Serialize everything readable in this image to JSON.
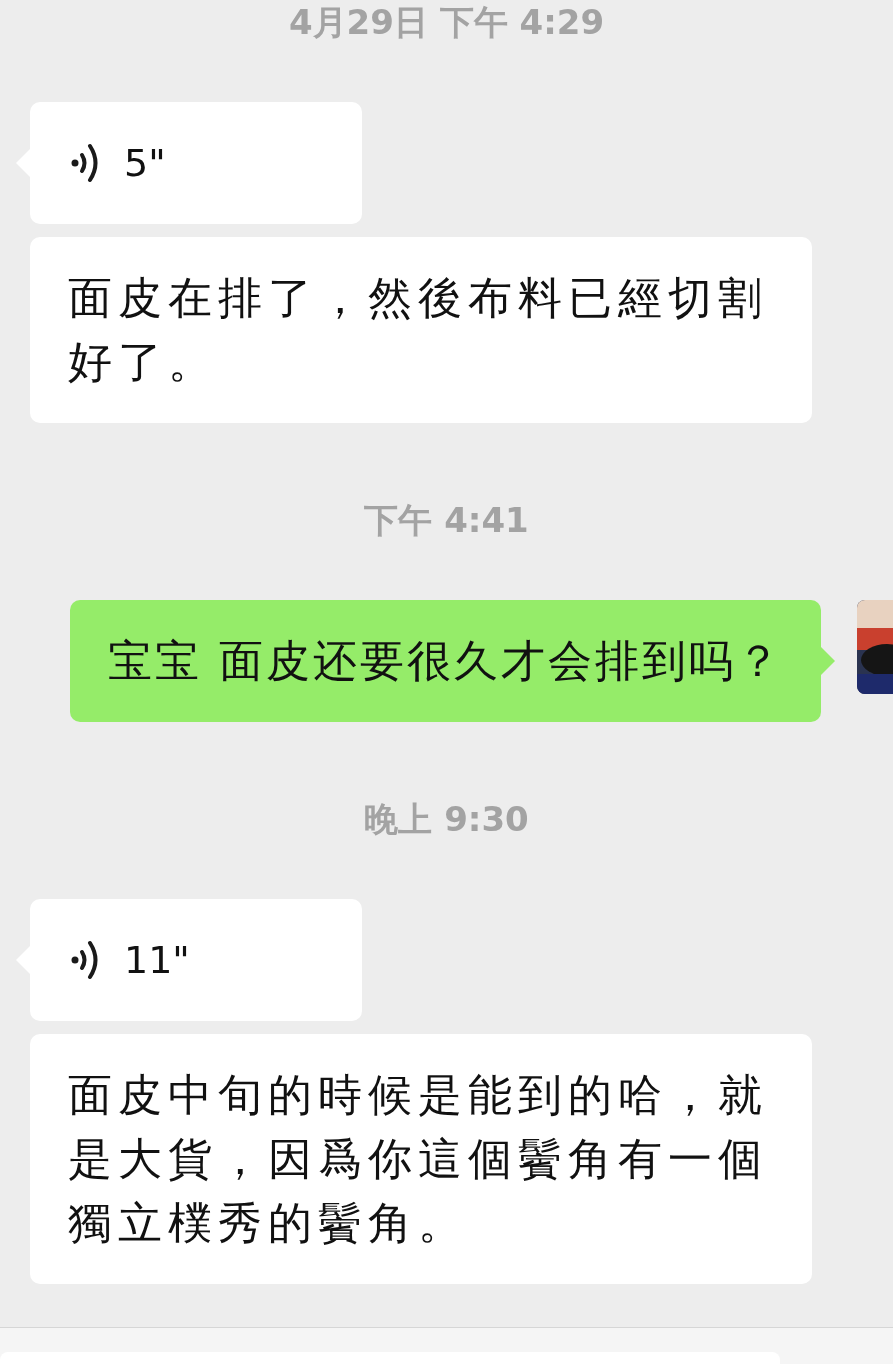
{
  "messages": [
    {
      "kind": "time",
      "text": "4月29日 下午 4:29"
    },
    {
      "kind": "voice",
      "outgoing": false,
      "tail": true,
      "duration": "5\""
    },
    {
      "kind": "text",
      "outgoing": false,
      "tail": false,
      "text": "面皮在排了，然後布料已經切割好了。"
    },
    {
      "kind": "time",
      "text": "下午 4:41"
    },
    {
      "kind": "text",
      "outgoing": true,
      "tail": true,
      "text": "宝宝 面皮还要很久才会排到吗？"
    },
    {
      "kind": "time",
      "text": "晚上 9:30"
    },
    {
      "kind": "voice",
      "outgoing": false,
      "tail": true,
      "duration": "11\""
    },
    {
      "kind": "text",
      "outgoing": false,
      "tail": false,
      "text": "面皮中旬的時候是能到的哈，就是大貨，因爲你這個鬢角有一個獨立樸秀的鬢角。"
    }
  ]
}
